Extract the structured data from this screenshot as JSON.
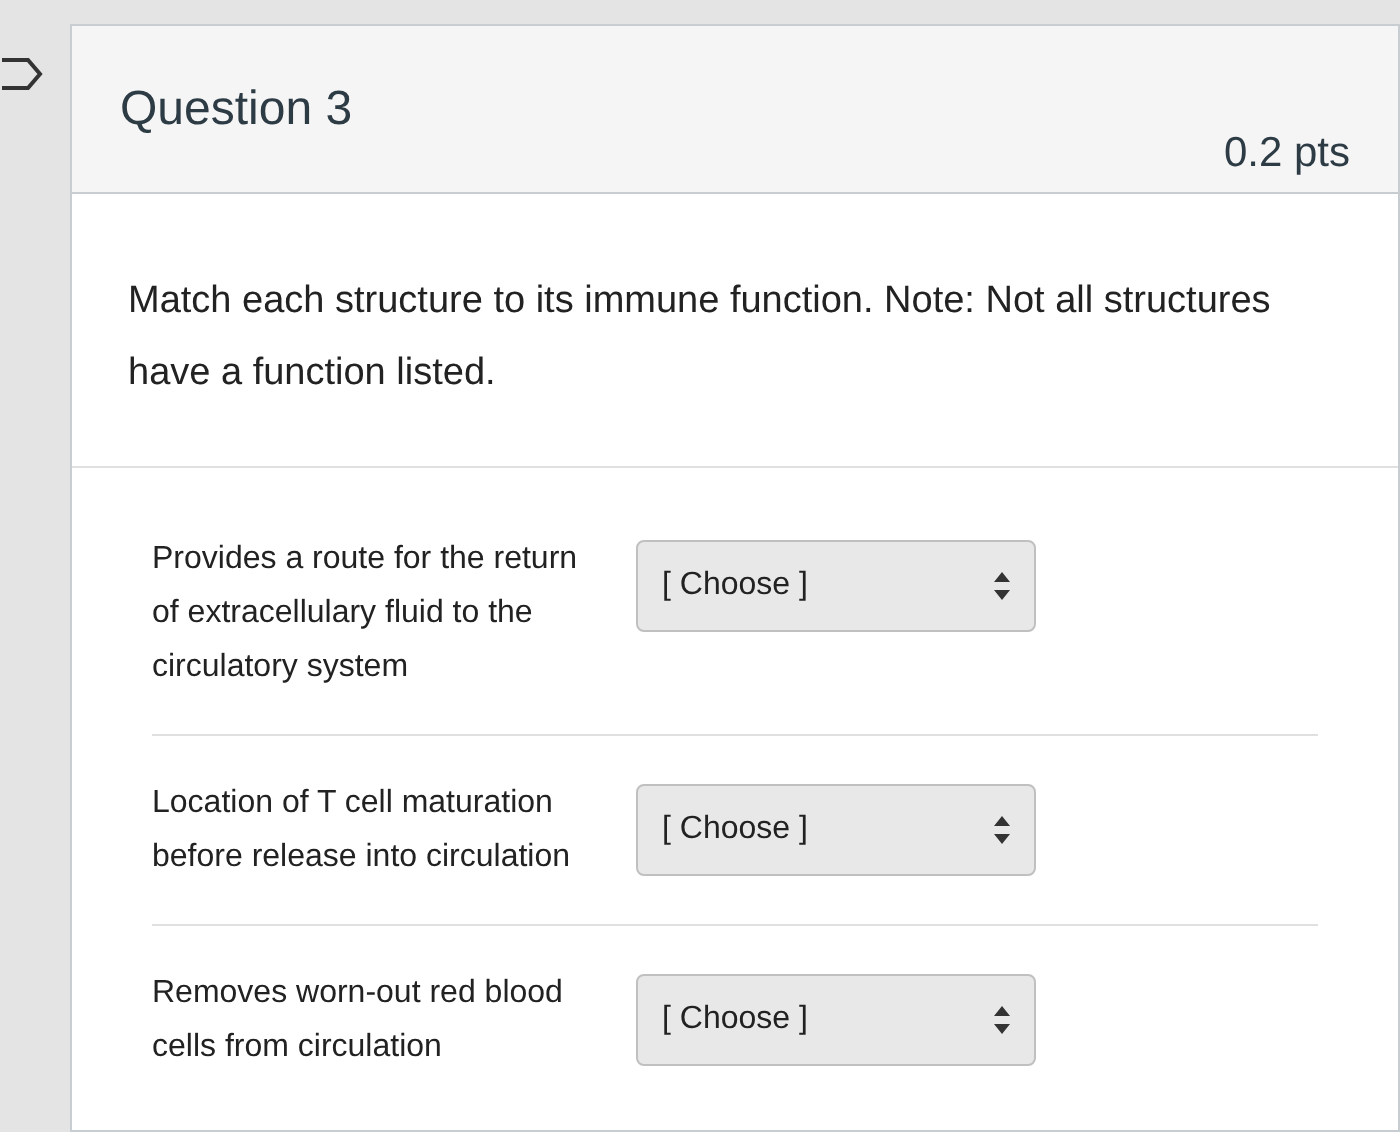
{
  "question": {
    "title": "Question 3",
    "points": "0.2 pts"
  },
  "prompt": "Match each structure to its immune function. Note: Not all structures have a function listed.",
  "matches": [
    {
      "label": "Provides a route for the return of extracellulary fluid to the circulatory system",
      "value": "[ Choose ]"
    },
    {
      "label": "Location of T cell maturation before release into circulation",
      "value": "[ Choose ]"
    },
    {
      "label": "Removes worn-out red blood cells from circulation",
      "value": "[ Choose ]"
    }
  ]
}
